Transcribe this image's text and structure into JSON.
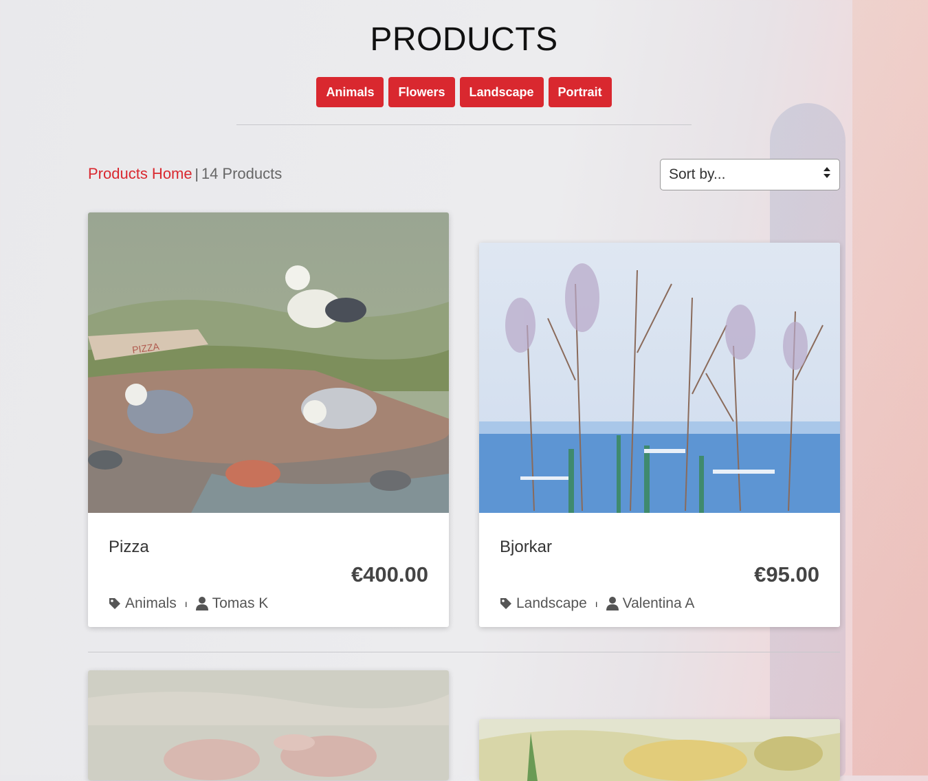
{
  "page": {
    "title": "PRODUCTS"
  },
  "categories": [
    "Animals",
    "Flowers",
    "Landscape",
    "Portrait"
  ],
  "breadcrumb": {
    "home": "Products Home",
    "separator": "|",
    "count": "14 Products"
  },
  "sort": {
    "placeholder": "Sort by..."
  },
  "products": [
    {
      "name": "Pizza",
      "price": "€400.00",
      "category": "Animals",
      "artist": "Tomas K"
    },
    {
      "name": "Bjorkar",
      "price": "€95.00",
      "category": "Landscape",
      "artist": "Valentina A"
    }
  ],
  "colors": {
    "accent": "#d9282f",
    "text": "#333333",
    "muted": "#666666"
  },
  "icons": {
    "tag": "tag-icon",
    "user": "user-icon",
    "sort": "sort-arrows-icon"
  }
}
